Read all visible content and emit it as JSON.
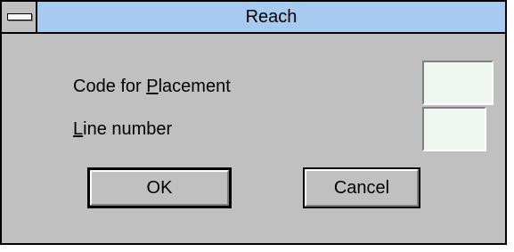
{
  "window": {
    "title": "Reach",
    "system_menu_icon": "system-menu-bar-icon"
  },
  "fields": {
    "placement": {
      "label_prefix": "Code for ",
      "label_mnemonic": "P",
      "label_suffix": "lacement",
      "value": ""
    },
    "line_number": {
      "label_prefix": "",
      "label_mnemonic": "L",
      "label_suffix": "ine number",
      "value": ""
    }
  },
  "buttons": {
    "ok_label": "OK",
    "cancel_label": "Cancel"
  }
}
